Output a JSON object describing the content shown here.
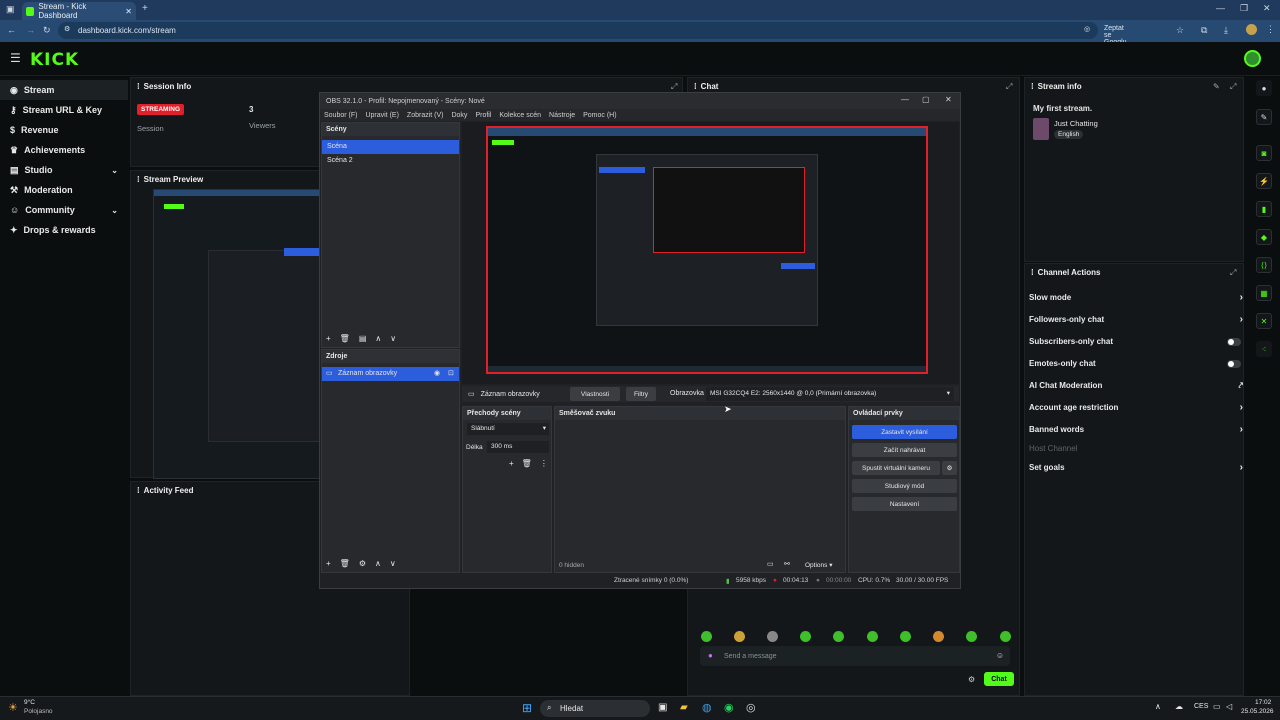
{
  "browser": {
    "tab_title": "Stream - Kick Dashboard",
    "url": "dashboard.kick.com/stream",
    "google_label": "Zeptat se Googlu"
  },
  "app": {
    "logo": "KICK"
  },
  "sidebar": {
    "items": [
      {
        "label": "Stream",
        "icon": "broadcast-icon"
      },
      {
        "label": "Stream URL & Key",
        "icon": "key-icon"
      },
      {
        "label": "Revenue",
        "icon": "revenue-icon"
      },
      {
        "label": "Achievements",
        "icon": "trophy-icon"
      },
      {
        "label": "Studio",
        "icon": "studio-icon"
      },
      {
        "label": "Moderation",
        "icon": "hammer-icon"
      },
      {
        "label": "Community",
        "icon": "community-icon"
      },
      {
        "label": "Drops & rewards",
        "icon": "gift-icon"
      }
    ]
  },
  "session": {
    "title": "Session Info",
    "status_badge": "STREAMING",
    "session_label": "Session",
    "viewers_value": "3",
    "viewers_label": "Viewers"
  },
  "preview": {
    "title": "Stream Preview"
  },
  "activity": {
    "title": "Activity Feed"
  },
  "chat": {
    "title": "Chat",
    "placeholder": "Send a message",
    "send_label": "Chat"
  },
  "stream_info": {
    "title": "Stream info",
    "stream_title": "My first stream.",
    "category": "Just Chatting",
    "language": "English"
  },
  "channel_actions": {
    "title": "Channel Actions",
    "items": [
      "Slow mode",
      "Followers-only chat",
      "Subscribers-only chat",
      "Emotes-only chat",
      "AI Chat Moderation",
      "Account age restriction",
      "Banned words",
      "Host Channel",
      "Set goals"
    ]
  },
  "obs": {
    "title": "OBS 32.1.0 - Profil: Nepojmenovaný - Scény: Nové",
    "menu": [
      "Soubor (F)",
      "Upravit (E)",
      "Zobrazit (V)",
      "Doky",
      "Profil",
      "Kolekce scén",
      "Nástroje",
      "Pomoc (H)"
    ],
    "scenes_title": "Scény",
    "scenes": [
      "Scéna",
      "Scéna 2"
    ],
    "sources_title": "Zdroje",
    "sources": [
      "Záznam obrazovky"
    ],
    "source_bar_name": "Záznam obrazovky",
    "props_label": "Vlastnosti",
    "filters_label": "Filtry",
    "screen_label": "Obrazovka",
    "screen_value": "MSI G32CQ4 E2: 2560x1440 @ 0,0 (Primární obrazovka)",
    "transitions_title": "Přechody scény",
    "transition_value": "Slábnutí",
    "duration_label": "Délka",
    "duration_value": "300 ms",
    "mixer_title": "Směšovač zvuku",
    "hidden_label": "0 hidden",
    "options_label": "Options",
    "controls_title": "Ovládací prvky",
    "controls": [
      "Zastavit vysílání",
      "Začít nahrávat",
      "Spustit virtuální kameru",
      "Studiový mód",
      "Nastavení"
    ],
    "status": {
      "dropped": "Ztracené snímky 0 (0.0%)",
      "bitrate": "5958 kbps",
      "live_time": "00:04:13",
      "rec_time": "00:00:00",
      "cpu": "CPU: 0.7%",
      "fps": "30.00 / 30.00 FPS"
    }
  },
  "taskbar": {
    "weather_temp": "9°C",
    "weather_desc": "Polojasno",
    "search_label": "Hledat",
    "lang": "CES",
    "time": "17:02",
    "date": "25.05.2026"
  },
  "colors": {
    "kick_green": "#53fc18",
    "streaming_red": "#e0202a",
    "obs_blue": "#2c5ddc"
  }
}
